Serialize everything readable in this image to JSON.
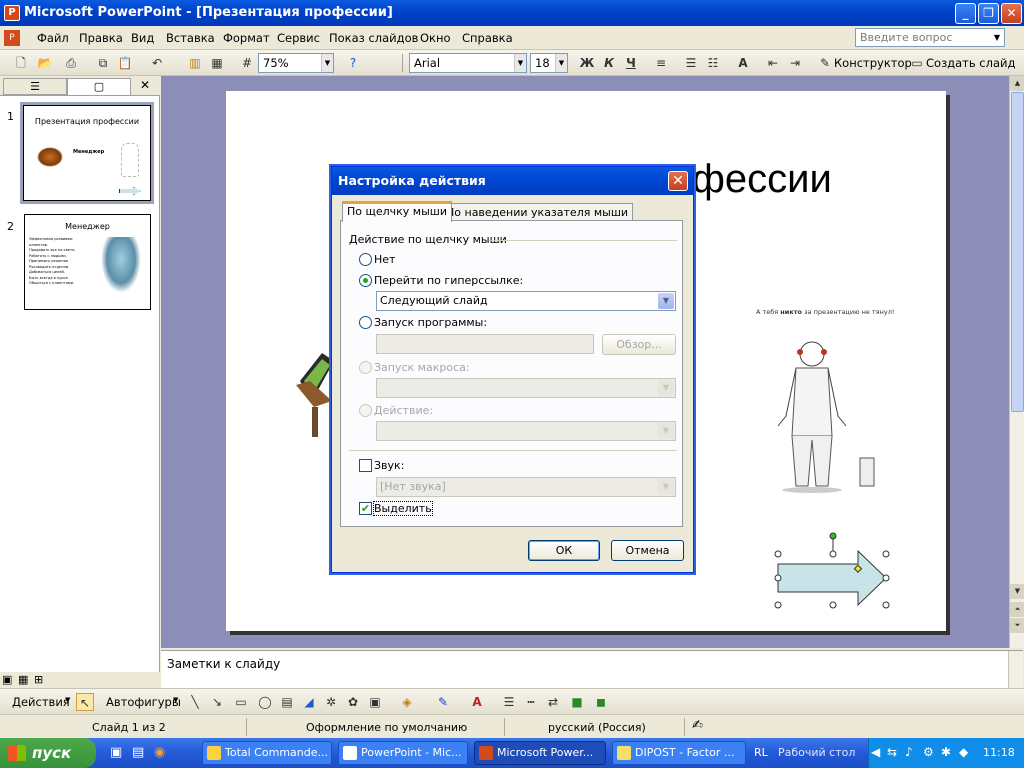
{
  "window": {
    "title": "Microsoft PowerPoint - [Презентация профессии]",
    "app_icon": "powerpoint-icon"
  },
  "menu": {
    "items": [
      "Файл",
      "Правка",
      "Вид",
      "Вставка",
      "Формат",
      "Сервис",
      "Показ слайдов",
      "Окно",
      "Справка"
    ],
    "ask_placeholder": "Введите вопрос"
  },
  "toolbar": {
    "zoom": "75%",
    "font": "Arial",
    "size": "18",
    "bold": "Ж",
    "italic": "К",
    "underline": "Ч",
    "designer": "Конструктор",
    "new_slide": "Создать слайд"
  },
  "slides": [
    {
      "num": "1",
      "title": "Презентация профессии",
      "label": "Менеджер"
    },
    {
      "num": "2",
      "title": "Менеджер",
      "lines": [
        "Эффективно развиваю клиентов.",
        "Продавать все на свете,",
        "Работать с людьми,",
        "Принимать решения",
        "Руководить отделом",
        "Добиваться целей.",
        "Быть всегда в курсе.",
        "Общаться с клиентами."
      ]
    }
  ],
  "slide": {
    "title_visible": "фессии",
    "caption_pre": "А тебя ",
    "caption_bold": "никто",
    "caption_post": " за презентацию не тянул!"
  },
  "notes": {
    "placeholder": "Заметки к слайду"
  },
  "dialog": {
    "title": "Настройка действия",
    "tab_click": "По щелчку мыши",
    "tab_hover": "По наведении указателя мыши",
    "group": "Действие по щелчку мыши",
    "opt_none": "Нет",
    "opt_link": "Перейти по гиперссылке:",
    "link_value": "Следующий слайд",
    "opt_program": "Запуск программы:",
    "browse": "Обзор...",
    "opt_macro": "Запуск макроса:",
    "opt_action": "Действие:",
    "sound": "Звук:",
    "sound_value": "[Нет звука]",
    "highlight": "Выделить",
    "ok": "ОК",
    "cancel": "Отмена"
  },
  "drawbar": {
    "actions": "Действия",
    "autoshapes": "Автофигуры"
  },
  "status": {
    "slide": "Слайд 1 из 2",
    "design": "Оформление по умолчанию",
    "lang": "русский (Россия)"
  },
  "taskbar": {
    "start": "пуск",
    "tasks": [
      "Total Commande...",
      "PowerPoint - Mic...",
      "Microsoft Power...",
      "DIPOST - Factor ..."
    ],
    "lang": "RL",
    "desktop": "Рабочий стол",
    "time": "11:18"
  }
}
